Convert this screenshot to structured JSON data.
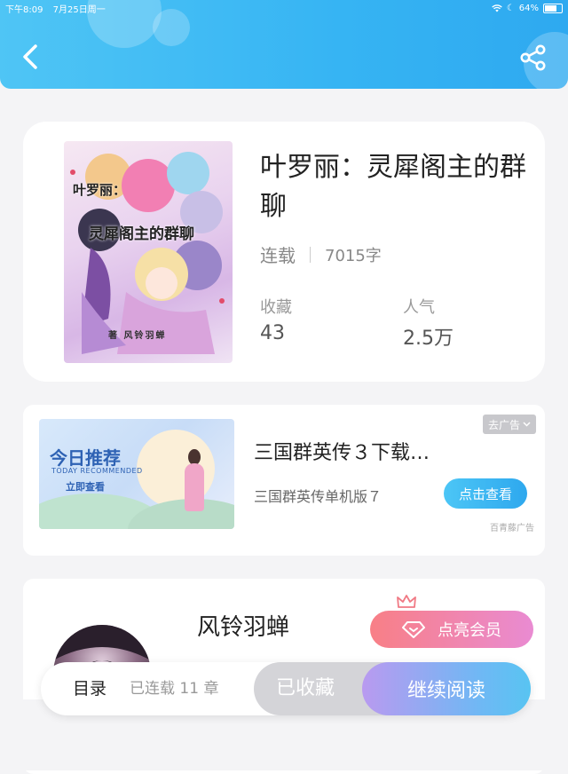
{
  "status_bar": {
    "time": "下午8:09",
    "date": "7月25日周一",
    "battery": "64%"
  },
  "book": {
    "cover_title_top": "叶罗丽：",
    "cover_title_main": "灵犀阁主的群聊",
    "cover_author": "著 风铃羽蝉",
    "title": "叶罗丽：灵犀阁主的群聊",
    "status": "连载",
    "word_count": "7015字",
    "favorites_label": "收藏",
    "favorites_value": "43",
    "popularity_label": "人气",
    "popularity_value": "2.5万"
  },
  "ad": {
    "image_title": "今日推荐",
    "image_subtitle": "TODAY RECOMMENDED",
    "image_cta": "立即查看",
    "title": "三国群英传３下载…",
    "subtitle": "三国群英传单机版７",
    "tag": "去广告",
    "button": "点击查看",
    "source": "百青藤广告"
  },
  "author": {
    "name": "风铃羽蝉",
    "vip_button": "点亮会员"
  },
  "bottom_bar": {
    "toc": "目录",
    "serial_status": "已连载 11 章",
    "favorited": "已收藏",
    "continue_reading": "继续阅读"
  },
  "colors": {
    "header": "#36b4f3",
    "accent": "#2ea8ee",
    "vip": "#f87f86"
  },
  "icons": [
    "back-arrow-icon",
    "share-icon",
    "chevron-down-icon",
    "crown-icon",
    "diamond-icon",
    "wifi-icon",
    "battery-icon"
  ]
}
